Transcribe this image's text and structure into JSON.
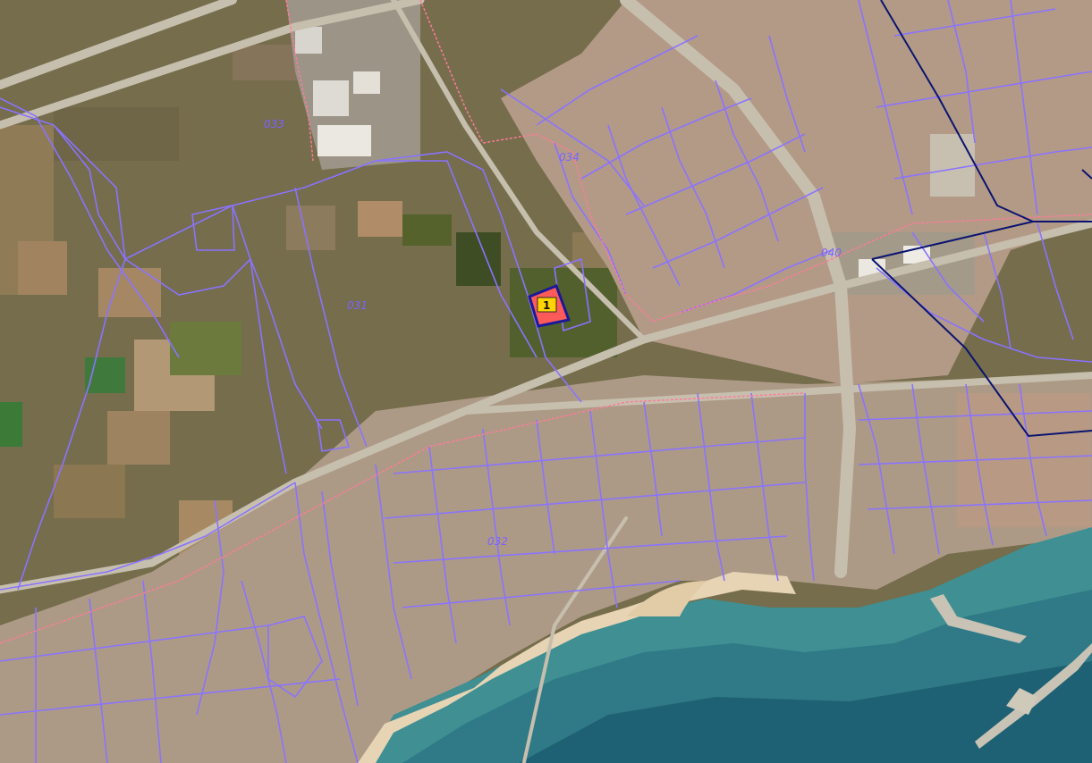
{
  "map": {
    "sector_labels": [
      "033",
      "034",
      "031",
      "032",
      "040"
    ],
    "selected_parcel": {
      "number": "1"
    },
    "colors": {
      "land": "#756d4c",
      "field_dry": "#9a8660",
      "field_green": "#5b6a32",
      "urban": "#b99a86",
      "sea_shallow": "#3f8f93",
      "sea_deep": "#1f6174",
      "beach": "#e7d4b4",
      "parcel_line": "#8a73ff",
      "urban_limit": "#ff7a9a",
      "sector_line": "#0a1470",
      "selected_fill": "#ff5a5a",
      "selected_border": "#1a1a99",
      "marker_fill": "#ffd400"
    }
  }
}
